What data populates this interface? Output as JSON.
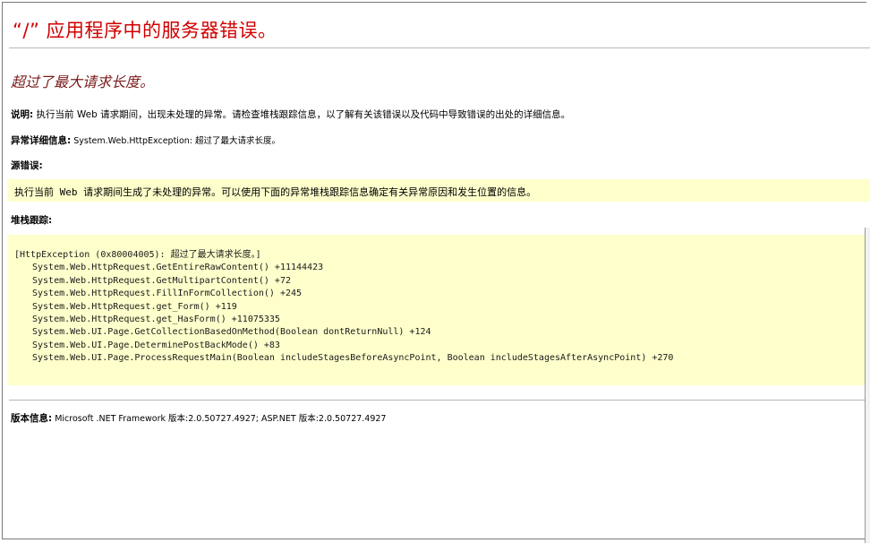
{
  "page": {
    "title": "“/” 应用程序中的服务器错误。",
    "error_message": "超过了最大请求长度。"
  },
  "description": {
    "label": "说明:",
    "text": " 执行当前 Web 请求期间，出现未处理的异常。请检查堆栈跟踪信息，以了解有关该错误以及代码中导致错误的出处的详细信息。"
  },
  "exception_details": {
    "label": "异常详细信息:",
    "text": " System.Web.HttpException: 超过了最大请求长度。"
  },
  "source_error": {
    "label": "源错误:",
    "text": "执行当前 Web 请求期间生成了未处理的异常。可以使用下面的异常堆栈跟踪信息确定有关异常原因和发生位置的信息。"
  },
  "stack_trace": {
    "label": "堆栈跟踪:",
    "header": "[HttpException (0x80004005): 超过了最大请求长度。]",
    "frames": [
      "System.Web.HttpRequest.GetEntireRawContent() +11144423",
      "System.Web.HttpRequest.GetMultipartContent() +72",
      "System.Web.HttpRequest.FillInFormCollection() +245",
      "System.Web.HttpRequest.get_Form() +119",
      "System.Web.HttpRequest.get_HasForm() +11075335",
      "System.Web.UI.Page.GetCollectionBasedOnMethod(Boolean dontReturnNull) +124",
      "System.Web.UI.Page.DeterminePostBackMode() +83",
      "System.Web.UI.Page.ProcessRequestMain(Boolean includeStagesBeforeAsyncPoint, Boolean includeStagesAfterAsyncPoint) +270"
    ]
  },
  "version_info": {
    "label": "版本信息:",
    "text": " Microsoft .NET Framework 版本:2.0.50727.4927; ASP.NET 版本:2.0.50727.4927"
  },
  "colors": {
    "title": "#d00000",
    "error_message": "#7a1a1a",
    "code_background": "#ffffcc"
  }
}
